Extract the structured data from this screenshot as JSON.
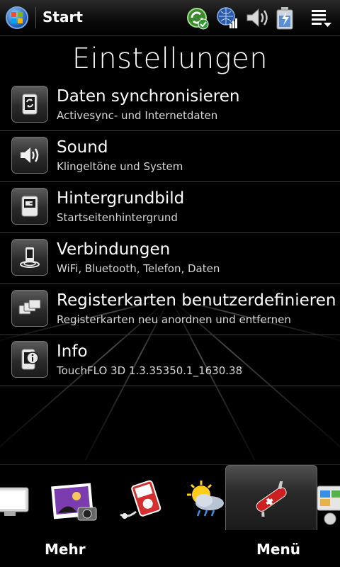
{
  "status_bar": {
    "title": "Start",
    "icons": [
      "windows-start-icon",
      "sync-ok-icon",
      "signal-icon",
      "volume-icon",
      "battery-icon",
      "menu-dropdown-icon"
    ]
  },
  "page": {
    "title": "Einstellungen"
  },
  "settings": [
    {
      "title": "Daten synchronisieren",
      "subtitle": "Activesync- und Internetdaten",
      "icon": "sync-phone-icon"
    },
    {
      "title": "Sound",
      "subtitle": "Klingeltöne und System",
      "icon": "speaker-icon"
    },
    {
      "title": "Hintergrundbild",
      "subtitle": "Startseitenhintergrund",
      "icon": "wallpaper-icon"
    },
    {
      "title": "Verbindungen",
      "subtitle": "WiFi, Bluetooth, Telefon, Daten",
      "icon": "connections-icon"
    },
    {
      "title": "Registerkarten benutzerdefinieren",
      "subtitle": "Registerkarten neu anordnen und entfernen",
      "icon": "tabs-icon"
    },
    {
      "title": "Info",
      "subtitle": "TouchFLO 3D 1.3.35350.1_1630.38",
      "icon": "info-icon"
    }
  ],
  "dock": {
    "tabs": [
      "monitor-icon",
      "photos-icon",
      "music-icon",
      "weather-icon",
      "settings-knife-icon",
      "programs-icon"
    ],
    "active_tab": "settings-knife-icon"
  },
  "softkeys": {
    "left": "Mehr",
    "right": "Menü"
  },
  "colors": {
    "background": "#000000",
    "divider": "#3b3b3b",
    "text": "#ffffff",
    "subtext": "#d6d6d6"
  }
}
